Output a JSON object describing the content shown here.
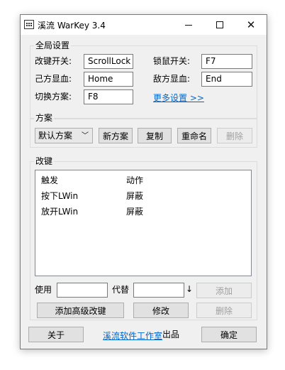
{
  "window": {
    "title": "溪流 WarKey 3.4"
  },
  "global": {
    "group_title": "全局设置",
    "key_switch_label": "改键开关:",
    "key_switch_value": "ScrollLock",
    "mouse_lock_label": "锁鼠开关:",
    "mouse_lock_value": "F7",
    "ally_hp_label": "己方显血:",
    "ally_hp_value": "Home",
    "enemy_hp_label": "敌方显血:",
    "enemy_hp_value": "End",
    "switch_scheme_label": "切换方案:",
    "switch_scheme_value": "F8",
    "more_settings_link": "更多设置 >>"
  },
  "scheme": {
    "group_title": "方案",
    "selected": "默认方案",
    "new_button": "新方案",
    "copy_button": "复制",
    "rename_button": "重命名",
    "delete_button": "删除"
  },
  "remap": {
    "group_title": "改键",
    "columns": [
      "触发",
      "动作"
    ],
    "rows": [
      {
        "trigger": "按下LWin",
        "action": "屏蔽"
      },
      {
        "trigger": "放开LWin",
        "action": "屏蔽"
      }
    ],
    "use_label": "使用",
    "use_value": "",
    "replace_label": "代替",
    "replace_value": "",
    "down_arrow": "↓",
    "add_button": "添加",
    "advanced_button": "添加高级改键",
    "modify_button": "修改",
    "delete_button": "删除"
  },
  "footer": {
    "about_button": "关于",
    "studio_link": "溪流软件工作室",
    "product_suffix": "出品",
    "ok_button": "确定"
  }
}
